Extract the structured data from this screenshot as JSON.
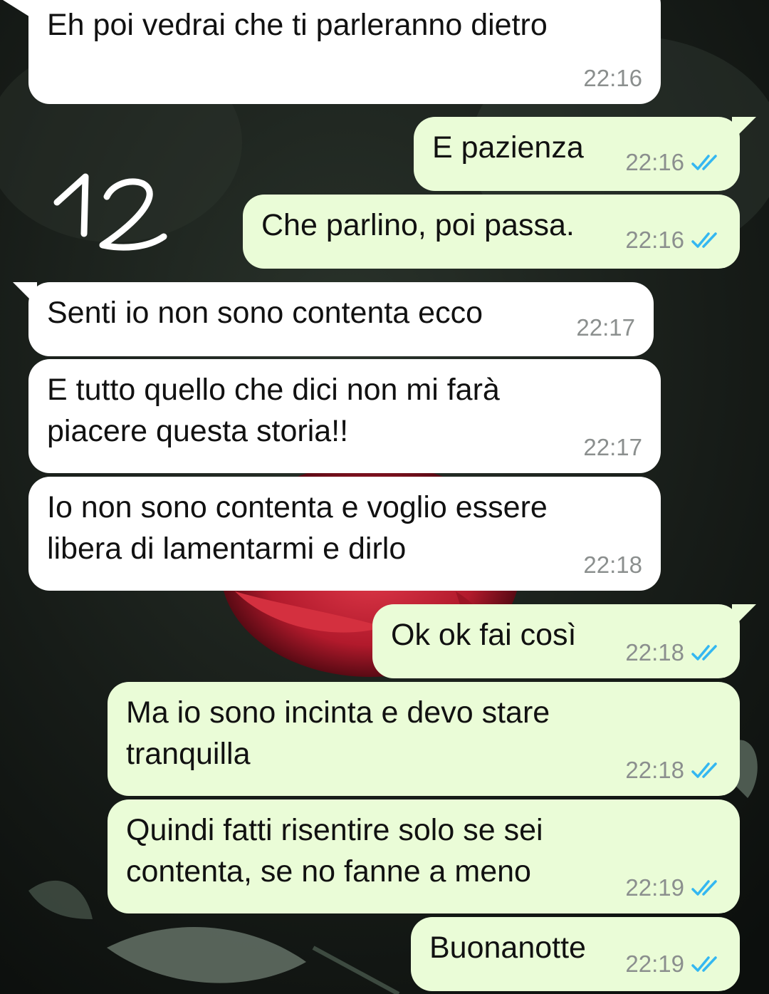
{
  "colors": {
    "incoming_bubble": "#ffffff",
    "outgoing_bubble": "#eafcd7",
    "timestamp": "#8b8f8e",
    "read_ticks": "#34b7f1"
  },
  "annotation": {
    "text": "12"
  },
  "messages": [
    {
      "direction": "incoming",
      "text": "Eh poi vedrai che ti parleranno dietro",
      "time": "22:16"
    },
    {
      "direction": "outgoing",
      "text": "E pazienza",
      "time": "22:16",
      "status_icon": "double-check-icon"
    },
    {
      "direction": "outgoing",
      "text": "Che parlino, poi passa.",
      "time": "22:16",
      "status_icon": "double-check-icon"
    },
    {
      "direction": "incoming",
      "text": "Senti io non sono contenta ecco",
      "time": "22:17"
    },
    {
      "direction": "incoming",
      "text": "E tutto quello che dici non mi farà\npiacere questa storia!!",
      "time": "22:17"
    },
    {
      "direction": "incoming",
      "text": "Io non sono contenta e voglio essere\nlibera di lamentarmi e dirlo",
      "time": "22:18"
    },
    {
      "direction": "outgoing",
      "text": "Ok ok fai così",
      "time": "22:18",
      "status_icon": "double-check-icon"
    },
    {
      "direction": "outgoing",
      "text": "Ma io sono incinta e devo stare\ntranquilla",
      "time": "22:18",
      "status_icon": "double-check-icon"
    },
    {
      "direction": "outgoing",
      "text": "Quindi fatti risentire solo se sei\ncontenta, se no fanne a meno",
      "time": "22:19",
      "status_icon": "double-check-icon"
    },
    {
      "direction": "outgoing",
      "text": "Buonanotte",
      "time": "22:19",
      "status_icon": "double-check-icon"
    }
  ]
}
